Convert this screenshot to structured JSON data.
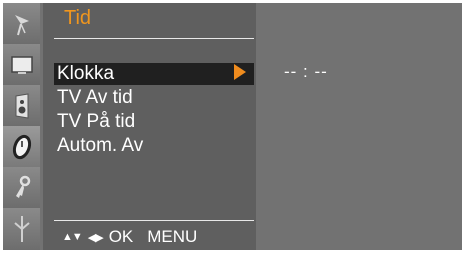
{
  "menu": {
    "title": "Tid",
    "items": [
      {
        "label": "Klokka",
        "selected": true
      },
      {
        "label": "TV Av tid",
        "selected": false
      },
      {
        "label": "TV På tid",
        "selected": false
      },
      {
        "label": "Autom.  Av",
        "selected": false
      }
    ],
    "submenu_arrow_icon": "triangle-right-icon",
    "value": "-- : --"
  },
  "sidebar": {
    "icons": [
      {
        "name": "antenna-icon",
        "active": false
      },
      {
        "name": "picture-icon",
        "active": false
      },
      {
        "name": "speaker-icon",
        "active": false
      },
      {
        "name": "clock-icon",
        "active": true
      },
      {
        "name": "key-icon",
        "active": false
      },
      {
        "name": "input-icon",
        "active": false
      }
    ]
  },
  "footer": {
    "updown_glyph": "▲▼",
    "leftright_glyph": "◀▶",
    "ok_label": "OK",
    "menu_label": "MENU"
  },
  "colors": {
    "accent": "#f0961e",
    "panel": "#5f5f5f",
    "background": "#727272",
    "selected_row": "#202020"
  }
}
